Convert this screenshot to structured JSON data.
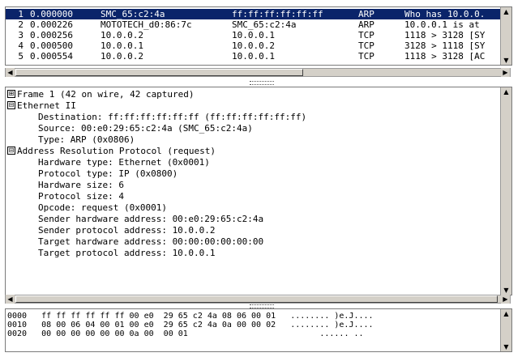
{
  "packet_list": {
    "rows": [
      {
        "no": "1",
        "time": "0.000000",
        "src": "SMC_65:c2:4a",
        "dst": "ff:ff:ff:ff:ff:ff",
        "proto": "ARP",
        "info": "Who has 10.0.0.",
        "selected": true
      },
      {
        "no": "2",
        "time": "0.000226",
        "src": "MOTOTECH_d0:86:7c",
        "dst": "SMC_65:c2:4a",
        "proto": "ARP",
        "info": "10.0.0.1 is at"
      },
      {
        "no": "3",
        "time": "0.000256",
        "src": "10.0.0.2",
        "dst": "10.0.0.1",
        "proto": "TCP",
        "info": "1118 > 3128 [SY"
      },
      {
        "no": "4",
        "time": "0.000500",
        "src": "10.0.0.1",
        "dst": "10.0.0.2",
        "proto": "TCP",
        "info": "3128 > 1118 [SY"
      },
      {
        "no": "5",
        "time": "0.000554",
        "src": "10.0.0.2",
        "dst": "10.0.0.1",
        "proto": "TCP",
        "info": "1118 > 3128 [AC"
      }
    ]
  },
  "tree": {
    "frame": {
      "expander": "⊞",
      "label": "Frame 1 (42 on wire, 42 captured)"
    },
    "ethernet": {
      "expander": "⊟",
      "label": "Ethernet II",
      "fields": [
        "Destination: ff:ff:ff:ff:ff:ff (ff:ff:ff:ff:ff:ff)",
        "Source: 00:e0:29:65:c2:4a (SMC_65:c2:4a)",
        "Type: ARP (0x0806)"
      ]
    },
    "arp": {
      "expander": "⊟",
      "label": "Address Resolution Protocol (request)",
      "fields": [
        "Hardware type: Ethernet (0x0001)",
        "Protocol type: IP (0x0800)",
        "Hardware size: 6",
        "Protocol size: 4",
        "Opcode: request (0x0001)",
        "Sender hardware address: 00:e0:29:65:c2:4a",
        "Sender protocol address: 10.0.0.2",
        "Target hardware address: 00:00:00:00:00:00",
        "Target protocol address: 10.0.0.1"
      ]
    }
  },
  "hex": {
    "lines": [
      {
        "offset": "0000",
        "bytes": "ff ff ff ff ff ff 00 e0  29 65 c2 4a 08 06 00 01",
        "ascii": "........ )e.J...."
      },
      {
        "offset": "0010",
        "bytes": "08 00 06 04 00 01 00 e0  29 65 c2 4a 0a 00 00 02",
        "ascii": "........ )e.J...."
      },
      {
        "offset": "0020",
        "bytes": "00 00 00 00 00 00 0a 00  00 01",
        "ascii": "...... .."
      }
    ]
  },
  "icons": {
    "scroll_up": "▲",
    "scroll_down": "▼",
    "scroll_left": "◀",
    "scroll_right": "▶"
  }
}
